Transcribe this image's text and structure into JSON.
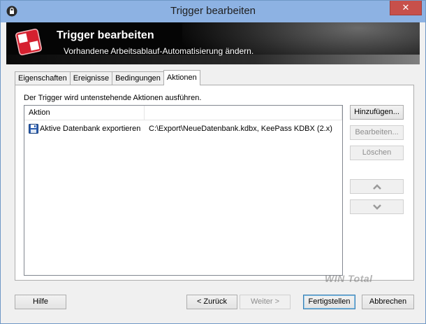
{
  "window": {
    "title": "Trigger bearbeiten",
    "close_glyph": "✕"
  },
  "banner": {
    "title": "Trigger bearbeiten",
    "subtitle": "Vorhandene Arbeitsablauf-Automatisierung ändern."
  },
  "tabs": [
    {
      "label": "Eigenschaften",
      "active": false
    },
    {
      "label": "Ereignisse",
      "active": false
    },
    {
      "label": "Bedingungen",
      "active": false
    },
    {
      "label": "Aktionen",
      "active": true
    }
  ],
  "panel": {
    "description": "Der Trigger wird untenstehende Aktionen ausführen.",
    "columns": [
      "Aktion",
      ""
    ],
    "rows": [
      {
        "icon": "save-disk-icon",
        "action": "Aktive Datenbank exportieren",
        "detail": "C:\\Export\\NeueDatenbank.kdbx, KeePass KDBX (2.x)"
      }
    ]
  },
  "side_buttons": {
    "add": "Hinzufügen...",
    "edit": "Bearbeiten...",
    "delete": "Löschen",
    "move_up_icon": "chevron-up-icon",
    "move_down_icon": "chevron-down-icon"
  },
  "footer": {
    "help": "Hilfe",
    "back": "< Zurück",
    "next": "Weiter >",
    "finish": "Fertigstellen",
    "cancel": "Abbrechen"
  },
  "watermark": "WIN Total",
  "colors": {
    "titlebar": "#8db2e3",
    "close": "#c7504b",
    "banner": "#050505",
    "logo_red": "#d5202f"
  }
}
